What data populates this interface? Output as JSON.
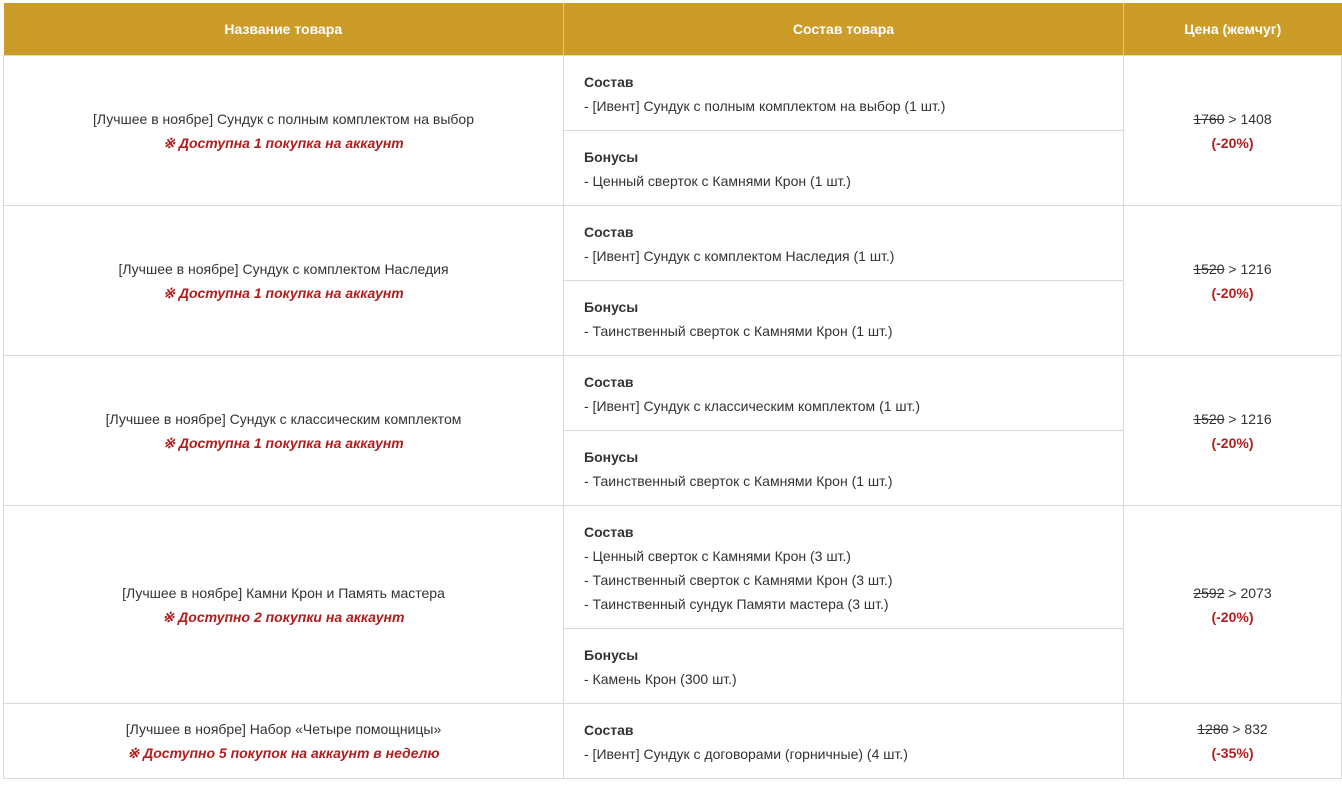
{
  "header": {
    "col_name": "Название товара",
    "col_contents": "Состав товара",
    "col_price": "Цена (жемчуг)"
  },
  "rows": [
    {
      "name": "[Лучшее в ноябре] Сундук с полным комплектом на выбор",
      "limit": "※ Доступна 1 покупка на аккаунт",
      "sections": [
        {
          "title": "Состав",
          "lines": [
            "- [Ивент] Сундук с полным комплектом на выбор (1 шт.)"
          ]
        },
        {
          "title": "Бонусы",
          "lines": [
            "- Ценный сверток с Камнями Крон (1 шт.)"
          ]
        }
      ],
      "old_price": "1760",
      "new_price": " > 1408",
      "discount": "(-20%)"
    },
    {
      "name": "[Лучшее в ноябре] Сундук с комплектом Наследия",
      "limit": "※ Доступна 1 покупка на аккаунт",
      "sections": [
        {
          "title": "Состав",
          "lines": [
            "- [Ивент] Сундук с комплектом Наследия (1 шт.)"
          ]
        },
        {
          "title": "Бонусы",
          "lines": [
            "- Таинственный сверток с Камнями Крон (1 шт.)"
          ]
        }
      ],
      "old_price": "1520",
      "new_price": " > 1216",
      "discount": "(-20%)"
    },
    {
      "name": "[Лучшее в ноябре] Сундук с классическим комплектом",
      "limit": "※ Доступна 1 покупка на аккаунт",
      "sections": [
        {
          "title": "Состав",
          "lines": [
            "- [Ивент] Сундук с классическим комплектом (1 шт.)"
          ]
        },
        {
          "title": "Бонусы",
          "lines": [
            "- Таинственный сверток с Камнями Крон (1 шт.)"
          ]
        }
      ],
      "old_price": "1520",
      "new_price": " > 1216",
      "discount": "(-20%)"
    },
    {
      "name": "[Лучшее в ноябре] Камни Крон и Память мастера",
      "limit": "※ Доступно 2 покупки на аккаунт",
      "sections": [
        {
          "title": "Состав",
          "lines": [
            "- Ценный сверток с Камнями Крон (3 шт.)",
            "- Таинственный сверток с Камнями Крон (3 шт.)",
            "- Таинственный сундук Памяти мастера (3 шт.)"
          ]
        },
        {
          "title": "Бонусы",
          "lines": [
            "- Камень Крон (300 шт.)"
          ]
        }
      ],
      "old_price": "2592",
      "new_price": " > 2073",
      "discount": "(-20%)"
    },
    {
      "name": "[Лучшее в ноябре] Набор «Четыре помощницы»",
      "limit": "※ Доступно 5 покупок на аккаунт в неделю",
      "sections": [
        {
          "title": "Состав",
          "lines": [
            "- [Ивент] Сундук с договорами (горничные) (4 шт.)"
          ]
        }
      ],
      "old_price": "1280",
      "new_price": " > 832",
      "discount": "(-35%)"
    }
  ]
}
